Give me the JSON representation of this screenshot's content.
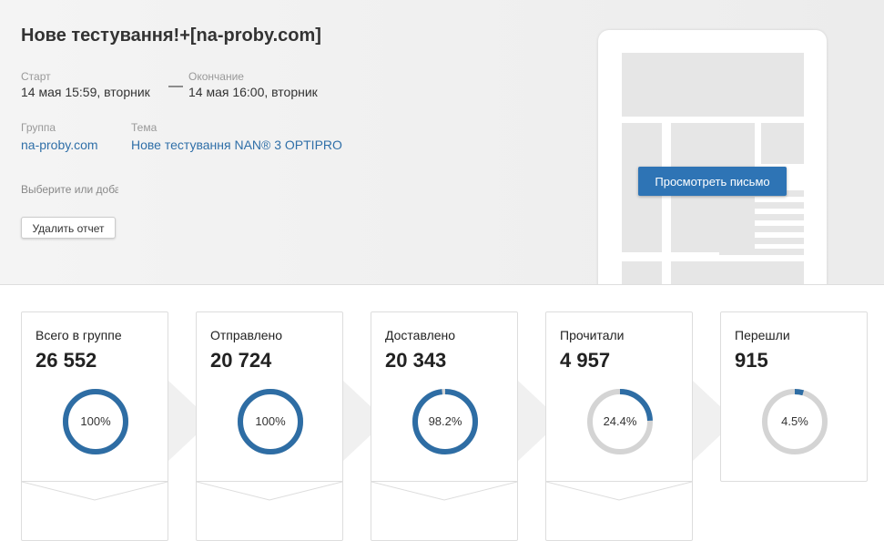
{
  "report": {
    "title": "Нове тестування!+[na-proby.com]",
    "start_label": "Старт",
    "start_value": "14 мая 15:59, вторник",
    "end_label": "Окончание",
    "end_value": "14 мая 16:00, вторник",
    "group_label": "Группа",
    "group_value": "na-proby.com",
    "subject_label": "Тема",
    "subject_value": "Нове тестування NAN® 3 OPTIPRO",
    "select_hint": "Выберите или добавьте",
    "delete_button": "Удалить отчет",
    "view_button": "Просмотреть письмо"
  },
  "stats": [
    {
      "label": "Всего в группе",
      "count": "26 552",
      "percent_text": "100%",
      "fraction": 1.0
    },
    {
      "label": "Отправлено",
      "count": "20 724",
      "percent_text": "100%",
      "fraction": 1.0
    },
    {
      "label": "Доставлено",
      "count": "20 343",
      "percent_text": "98.2%",
      "fraction": 0.982
    },
    {
      "label": "Прочитали",
      "count": "4 957",
      "percent_text": "24.4%",
      "fraction": 0.244
    },
    {
      "label": "Перешли",
      "count": "915",
      "percent_text": "4.5%",
      "fraction": 0.045
    }
  ],
  "colors": {
    "ring_accent": "#2e6da4",
    "ring_track": "#d4d4d4",
    "link": "#2f6fa8",
    "button": "#2e74b5"
  }
}
